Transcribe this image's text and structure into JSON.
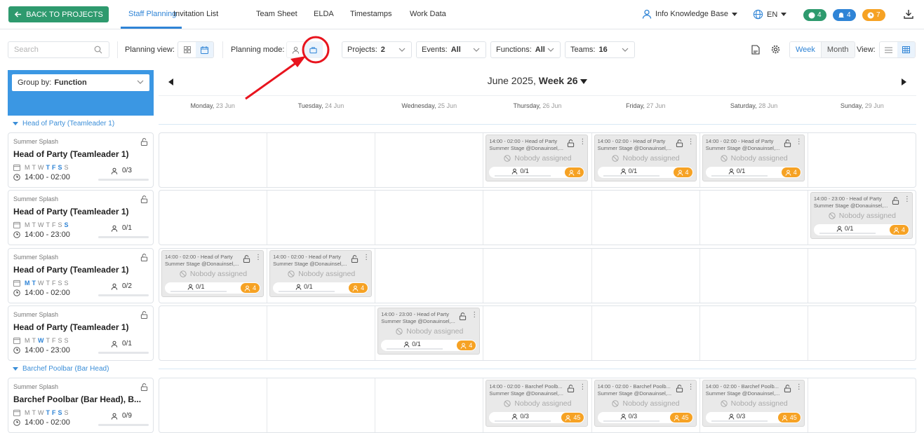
{
  "topbar": {
    "back_label": "BACK TO PROJECTS",
    "tabs": [
      {
        "label": "Staff Planning",
        "active": true
      },
      {
        "label": "Invitation List"
      },
      {
        "label": "Team Sheet"
      },
      {
        "label": "ELDA"
      },
      {
        "label": "Timestamps"
      },
      {
        "label": "Work Data"
      }
    ],
    "knowledge_base": "Info Knowledge Base",
    "language": "EN",
    "badges": [
      {
        "icon": "chat-icon",
        "count": "4",
        "color": "#2e9a6e"
      },
      {
        "icon": "bell-icon",
        "count": "4",
        "color": "#2f84d6"
      },
      {
        "icon": "clock-icon",
        "count": "7",
        "color": "#f6a224"
      }
    ]
  },
  "toolbar": {
    "search_placeholder": "Search",
    "planning_view_label": "Planning view:",
    "planning_mode_label": "Planning mode:",
    "filters": [
      {
        "label": "Projects:",
        "value": "2"
      },
      {
        "label": "Events:",
        "value": "All"
      },
      {
        "label": "Functions:",
        "value": "All"
      },
      {
        "label": "Teams:",
        "value": "16"
      }
    ],
    "week_label": "Week",
    "month_label": "Month",
    "view_label": "View:"
  },
  "group_by": {
    "label": "Group by:",
    "value": "Function"
  },
  "calendar": {
    "month_label": "June 2025,",
    "week_label": "Week 26",
    "days": [
      {
        "name": "Monday,",
        "date": "23 Jun"
      },
      {
        "name": "Tuesday,",
        "date": "24 Jun"
      },
      {
        "name": "Wednesday,",
        "date": "25 Jun"
      },
      {
        "name": "Thursday,",
        "date": "26 Jun"
      },
      {
        "name": "Friday,",
        "date": "27 Jun"
      },
      {
        "name": "Saturday,",
        "date": "28 Jun"
      },
      {
        "name": "Sunday,",
        "date": "29 Jun"
      }
    ]
  },
  "groups": [
    {
      "label": "Head of Party (Teamleader 1)"
    },
    {
      "label": "Barchef Poolbar (Bar Head)"
    }
  ],
  "rows": [
    {
      "event": "Summer Splash",
      "title": "Head of Party (Teamleader 1)",
      "weekday_letters": [
        "M",
        "T",
        "W",
        "T",
        "F",
        "S",
        "S"
      ],
      "highlighted_days": [
        3,
        4,
        5
      ],
      "time": "14:00 - 02:00",
      "count": "0/3",
      "shifts": [
        {
          "day": 3,
          "line1": "14:00 - 02:00 - Head of Party",
          "line2": "Summer Stage @Donauinsel,...",
          "nobody": "Nobody assigned",
          "assigned": "0/1",
          "badge": "4"
        },
        {
          "day": 4,
          "line1": "14:00 - 02:00 - Head of Party",
          "line2": "Summer Stage @Donauinsel,...",
          "nobody": "Nobody assigned",
          "assigned": "0/1",
          "badge": "4"
        },
        {
          "day": 5,
          "line1": "14:00 - 02:00 - Head of Party",
          "line2": "Summer Stage @Donauinsel,...",
          "nobody": "Nobody assigned",
          "assigned": "0/1",
          "badge": "4"
        }
      ]
    },
    {
      "event": "Summer Splash",
      "title": "Head of Party (Teamleader 1)",
      "weekday_letters": [
        "M",
        "T",
        "W",
        "T",
        "F",
        "S",
        "S"
      ],
      "highlighted_days": [
        6
      ],
      "time": "14:00 - 23:00",
      "count": "0/1",
      "shifts": [
        {
          "day": 6,
          "line1": "14:00 - 23:00 - Head of Party",
          "line2": "Summer Stage @Donauinsel,...",
          "nobody": "Nobody assigned",
          "assigned": "0/1",
          "badge": "4"
        }
      ]
    },
    {
      "event": "Summer Splash",
      "title": "Head of Party (Teamleader 1)",
      "weekday_letters": [
        "M",
        "T",
        "W",
        "T",
        "F",
        "S",
        "S"
      ],
      "highlighted_days": [
        0,
        1
      ],
      "time": "14:00 - 02:00",
      "count": "0/2",
      "shifts": [
        {
          "day": 0,
          "line1": "14:00 - 02:00 - Head of Party",
          "line2": "Summer Stage @Donauinsel,...",
          "nobody": "Nobody assigned",
          "assigned": "0/1",
          "badge": "4"
        },
        {
          "day": 1,
          "line1": "14:00 - 02:00 - Head of Party",
          "line2": "Summer Stage @Donauinsel,...",
          "nobody": "Nobody assigned",
          "assigned": "0/1",
          "badge": "4"
        }
      ]
    },
    {
      "event": "Summer Splash",
      "title": "Head of Party (Teamleader 1)",
      "weekday_letters": [
        "M",
        "T",
        "W",
        "T",
        "F",
        "S",
        "S"
      ],
      "highlighted_days": [
        2
      ],
      "time": "14:00 - 23:00",
      "count": "0/1",
      "shifts": [
        {
          "day": 2,
          "line1": "14:00 - 23:00 - Head of Party",
          "line2": "Summer Stage @Donauinsel,...",
          "nobody": "Nobody assigned",
          "assigned": "0/1",
          "badge": "4"
        }
      ]
    },
    {
      "event": "Summer Splash",
      "title": "Barchef Poolbar (Bar Head), B...",
      "weekday_letters": [
        "M",
        "T",
        "W",
        "T",
        "F",
        "S",
        "S"
      ],
      "highlighted_days": [
        3,
        4,
        5
      ],
      "time": "14:00 - 02:00",
      "count": "0/9",
      "shifts": [
        {
          "day": 3,
          "line1": "14:00 - 02:00 - Barchef Poolb...",
          "line2": "Summer Stage @Donauinsel,...",
          "nobody": "Nobody assigned",
          "assigned": "0/3",
          "badge": "45"
        },
        {
          "day": 4,
          "line1": "14:00 - 02:00 - Barchef Poolb...",
          "line2": "Summer Stage @Donauinsel,...",
          "nobody": "Nobody assigned",
          "assigned": "0/3",
          "badge": "45"
        },
        {
          "day": 5,
          "line1": "14:00 - 02:00 - Barchef Poolb...",
          "line2": "Summer Stage @Donauinsel,...",
          "nobody": "Nobody assigned",
          "assigned": "0/3",
          "badge": "45"
        }
      ]
    }
  ],
  "colors": {
    "accent": "#2f84d6",
    "primary_green": "#2e9a6e",
    "orange": "#f6a224",
    "annotation": "#e8141e"
  }
}
